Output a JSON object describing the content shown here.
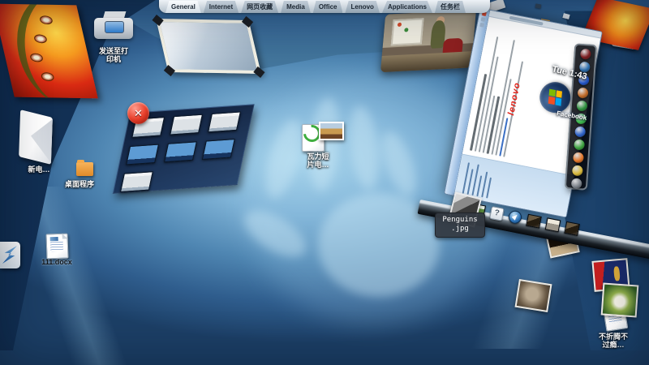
{
  "tab_bar": {
    "tabs": [
      {
        "label": "General",
        "active": true
      },
      {
        "label": "Internet",
        "active": false
      },
      {
        "label": "网页收藏",
        "active": false
      },
      {
        "label": "Media",
        "active": false
      },
      {
        "label": "Office",
        "active": false
      },
      {
        "label": "Lenovo",
        "active": false
      },
      {
        "label": "Applications",
        "active": false
      },
      {
        "label": "任务栏",
        "active": false
      }
    ]
  },
  "wall_items": {
    "printer_label": [
      "发送至打",
      "印机"
    ],
    "email_label": "新电…",
    "program_label": "桌面程序"
  },
  "floor_items": {
    "doc_label": "111.docx",
    "media_label": [
      "瓦力短",
      "片电…"
    ],
    "close_glyph": "✕",
    "penguins_tooltip": [
      "Penguins",
      ".jpg"
    ],
    "notoss_label": [
      "不折腾不",
      "过瘾…"
    ]
  },
  "window": {
    "brand": "lenovo",
    "clock": "Tue 1:43"
  },
  "dock": {
    "facebook_label": "Facebook",
    "icons": [
      {
        "name": "dock-app-red-sphere-icon",
        "color": "#7a1d20"
      },
      {
        "name": "dock-app-globe-icon",
        "color": "#2e6fae"
      },
      {
        "name": "dock-app-blue-icon",
        "color": "#2456c8"
      },
      {
        "name": "dock-app-amber-icon",
        "color": "#c06a28"
      },
      {
        "name": "dock-app-green-sphere-icon",
        "color": "#2e8f3e"
      },
      {
        "name": "dock-app-bright-green-icon",
        "color": "#3fc24f"
      },
      {
        "name": "dock-app-azure-icon",
        "color": "#2f63c9"
      },
      {
        "name": "dock-app-leaf-icon",
        "color": "#3da23f"
      },
      {
        "name": "dock-app-orange-ball-icon",
        "color": "#e2762a"
      },
      {
        "name": "dock-app-gold-icon",
        "color": "#d8b83a"
      },
      {
        "name": "dock-app-gray-icon",
        "color": "#7a8088"
      }
    ]
  },
  "photo_group": {
    "thumbnails": [
      {
        "style": "light"
      },
      {
        "style": "light"
      },
      {
        "style": "light"
      },
      {
        "style": "blue"
      },
      {
        "style": "blue"
      },
      {
        "style": "blue"
      },
      {
        "style": "light"
      }
    ]
  },
  "shelf": {
    "items": [
      {
        "style": "photo-dark"
      },
      {
        "style": "photo-green"
      },
      {
        "style": "icon-question",
        "glyph": "?"
      },
      {
        "style": "icon-compass"
      },
      {
        "style": "photo-dark"
      },
      {
        "style": "photo-light"
      },
      {
        "style": "photo-dark"
      }
    ]
  },
  "colors": {
    "floor_blue": "#4a80ad",
    "wall_navy": "#1d4168",
    "accent_red": "#d92a12",
    "lenovo_red": "#e2231a",
    "close_red": "#e8402c"
  }
}
